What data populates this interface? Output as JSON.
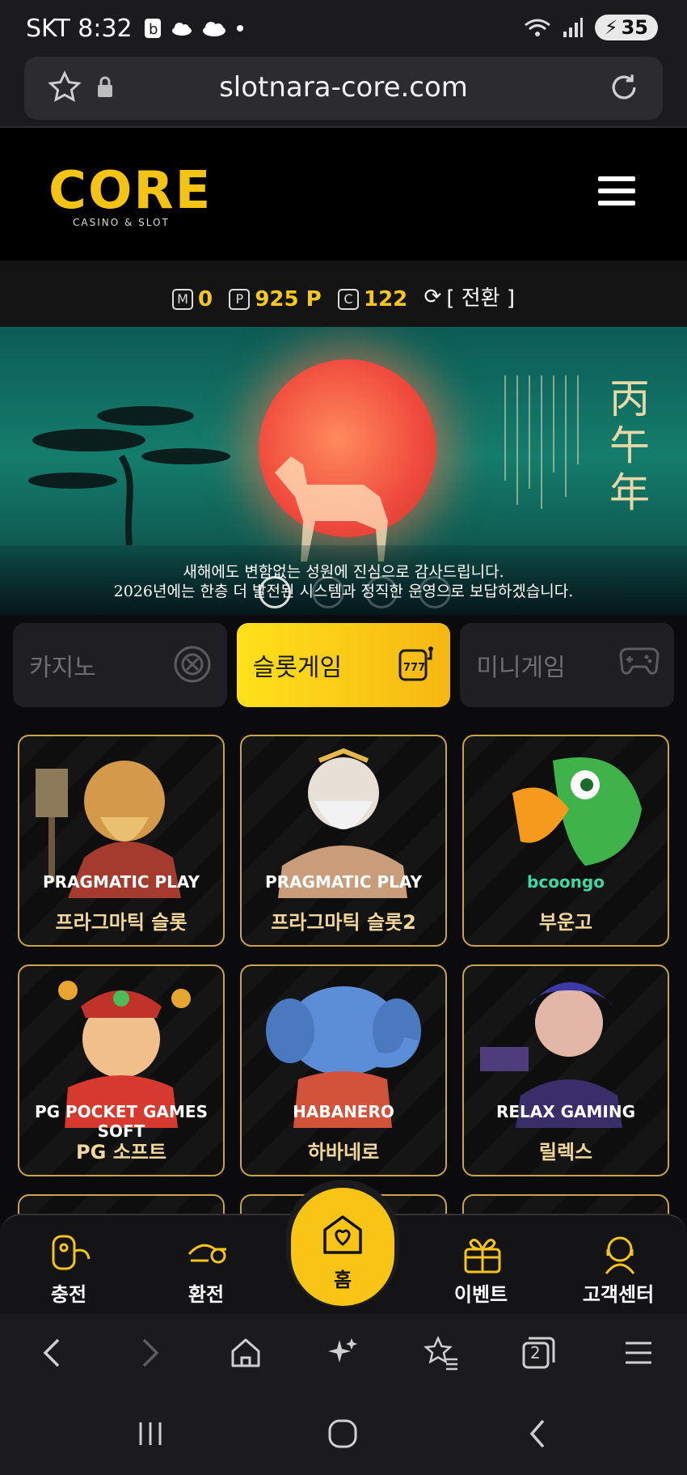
{
  "status_bar": {
    "carrier": "SKT",
    "time": "8:32",
    "battery": "35",
    "wifi_label": "5"
  },
  "browser": {
    "url": "slotnara-core.com",
    "icons": {
      "bookmark": "star-icon",
      "lock": "lock-icon",
      "reload": "reload-icon"
    }
  },
  "site": {
    "logo_text": "CORE",
    "logo_sub": "CASINO & SLOT"
  },
  "points": {
    "m_label": "M",
    "m_value": "0",
    "p_label": "P",
    "p_value": "925 P",
    "c_label": "C",
    "c_value": "122",
    "switch_label": "[ 전환 ]"
  },
  "banner": {
    "vertical_title": "丙午年",
    "caption_line1": "새해에도 변함없는 성원에 진심으로 감사드립니다.",
    "caption_line2": "2026년에는 한층 더 발전된 시스템과 정직한 운영으로 보답하겠습니다."
  },
  "tabs": [
    {
      "label": "카지노",
      "icon": "roulette-icon",
      "active": false
    },
    {
      "label": "슬롯게임",
      "icon": "slot-machine-icon",
      "active": true
    },
    {
      "label": "미니게임",
      "icon": "gamepad-icon",
      "active": false
    }
  ],
  "games": [
    {
      "provider": "PRAGMATIC PLAY",
      "name": "프라그마틱 슬롯"
    },
    {
      "provider": "PRAGMATIC PLAY",
      "name": "프라그마틱 슬롯2"
    },
    {
      "provider": "bcoongo",
      "name": "부운고"
    },
    {
      "provider": "PG POCKET GAMES SOFT",
      "name": "PG 소프트"
    },
    {
      "provider": "HABANERO",
      "name": "하바네로"
    },
    {
      "provider": "RELAX GAMING",
      "name": "릴렉스"
    }
  ],
  "bottom_nav": {
    "charge": "충전",
    "exchange": "환전",
    "home": "홈",
    "event": "이벤트",
    "support": "고객센터"
  },
  "browser_bar": {
    "tab_count": "2"
  },
  "colors": {
    "accent": "#f8c416",
    "card_border": "#c9a24c",
    "background": "#0b0b0d"
  }
}
